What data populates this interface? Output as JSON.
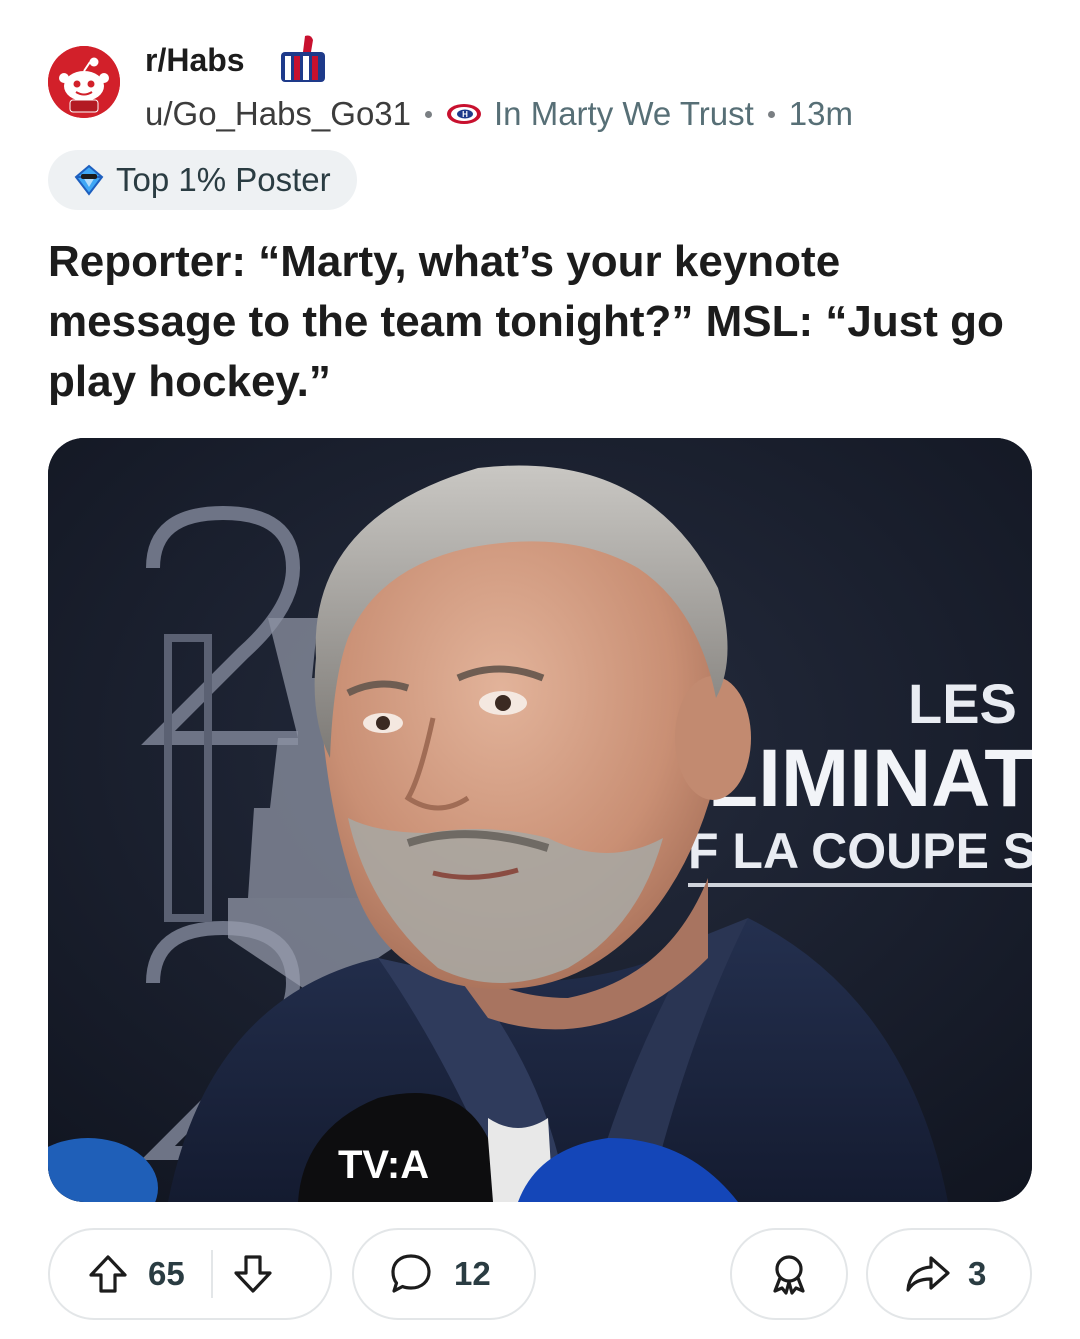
{
  "post": {
    "subreddit": "r/Habs",
    "author": "u/Go_Habs_Go31",
    "flair": "In Marty We Trust",
    "time_ago": "13m",
    "badge": "Top 1% Poster",
    "title": "Reporter: “Marty, what’s your keynote message to the team tonight?” MSL: “Just go play hockey.”"
  },
  "image": {
    "backdrop_texts": [
      "LES S",
      "LIMINATO",
      "F LA COUPE STA"
    ],
    "mic_logo_text": "TV:A"
  },
  "actions": {
    "upvotes": "65",
    "comments": "12",
    "shares": "3"
  },
  "colors": {
    "avatar_bg": "#d2202a",
    "habs_red": "#c8102e",
    "habs_blue": "#1e3a8a",
    "text_secondary": "#576f76",
    "pill_border": "#e3e6e8"
  },
  "icons": [
    "snoo-avatar-icon",
    "thumbs-up-icon",
    "habs-logo-icon",
    "diamond-badge-icon",
    "upvote-icon",
    "downvote-icon",
    "comment-icon",
    "award-icon",
    "share-icon"
  ]
}
